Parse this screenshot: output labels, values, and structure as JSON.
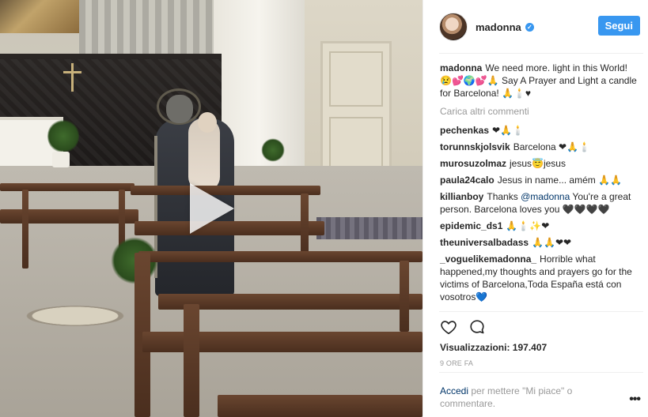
{
  "post": {
    "username": "madonna",
    "follow_label": "Segui",
    "caption_user": "madonna",
    "caption_text": "We need more. light in this World! 😢💕🌍💕🙏 Say A Prayer and Light a candle for Barcelona! 🙏🕯️♥",
    "load_more": "Carica altri commenti"
  },
  "comments": [
    {
      "user": "pechenkas",
      "text": "❤🙏🕯️"
    },
    {
      "user": "torunnskjolsvik",
      "text": "Barcelona ❤🙏🕯️"
    },
    {
      "user": "murosuzolmaz",
      "text": "jesus😇jesus"
    },
    {
      "user": "paula24calo",
      "text": "Jesus in name... amém 🙏🙏"
    },
    {
      "user": "killianboy",
      "text_before": "Thanks",
      "mention": "@madonna",
      "text_after": "You're a great person. Barcelona loves you 🖤🖤🖤🖤"
    },
    {
      "user": "epidemic_ds1",
      "text": "🙏🕯️✨❤"
    },
    {
      "user": "theuniversalbadass",
      "text": "🙏🙏❤❤"
    },
    {
      "user": "_voguelikemadonna_",
      "text": "Horrible what happened,my thoughts and prayers go for the victims of Barcelona,Toda España está con vosotros💙"
    }
  ],
  "stats": {
    "views": "Visualizzazioni: 197.407",
    "time": "9 ORE FA"
  },
  "login": {
    "link": "Accedi",
    "text": "per mettere \"Mi piace\" o commentare."
  },
  "icons": {
    "like": "heart-icon",
    "comment": "comment-icon",
    "more": "more-options-icon",
    "play": "play-icon",
    "verified": "verified-badge-icon"
  },
  "colors": {
    "accent": "#3897f0",
    "link": "#003569",
    "muted": "#999999"
  }
}
